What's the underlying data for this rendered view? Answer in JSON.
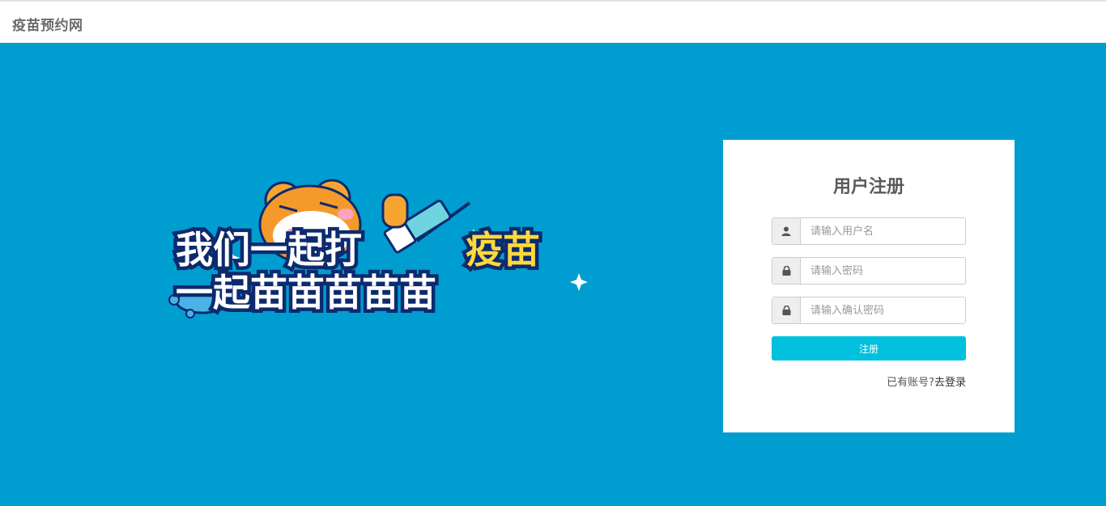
{
  "header": {
    "site_title": "疫苗预约网"
  },
  "banner": {
    "line1_white": "我们一起打",
    "line1_yellow": "疫苗",
    "line2": "一起苗苗苗苗苗"
  },
  "register_form": {
    "title": "用户注册",
    "username_placeholder": "请输入用户名",
    "password_placeholder": "请输入密码",
    "confirm_placeholder": "请输入确认密码",
    "submit_label": "注册",
    "login_prompt": "已有账号?",
    "login_link": "去登录"
  },
  "colors": {
    "hero_background": "#009dd0",
    "submit_button": "#00c0dd",
    "banner_yellow": "#ffd93b",
    "banner_outline": "#0d2a6e"
  }
}
